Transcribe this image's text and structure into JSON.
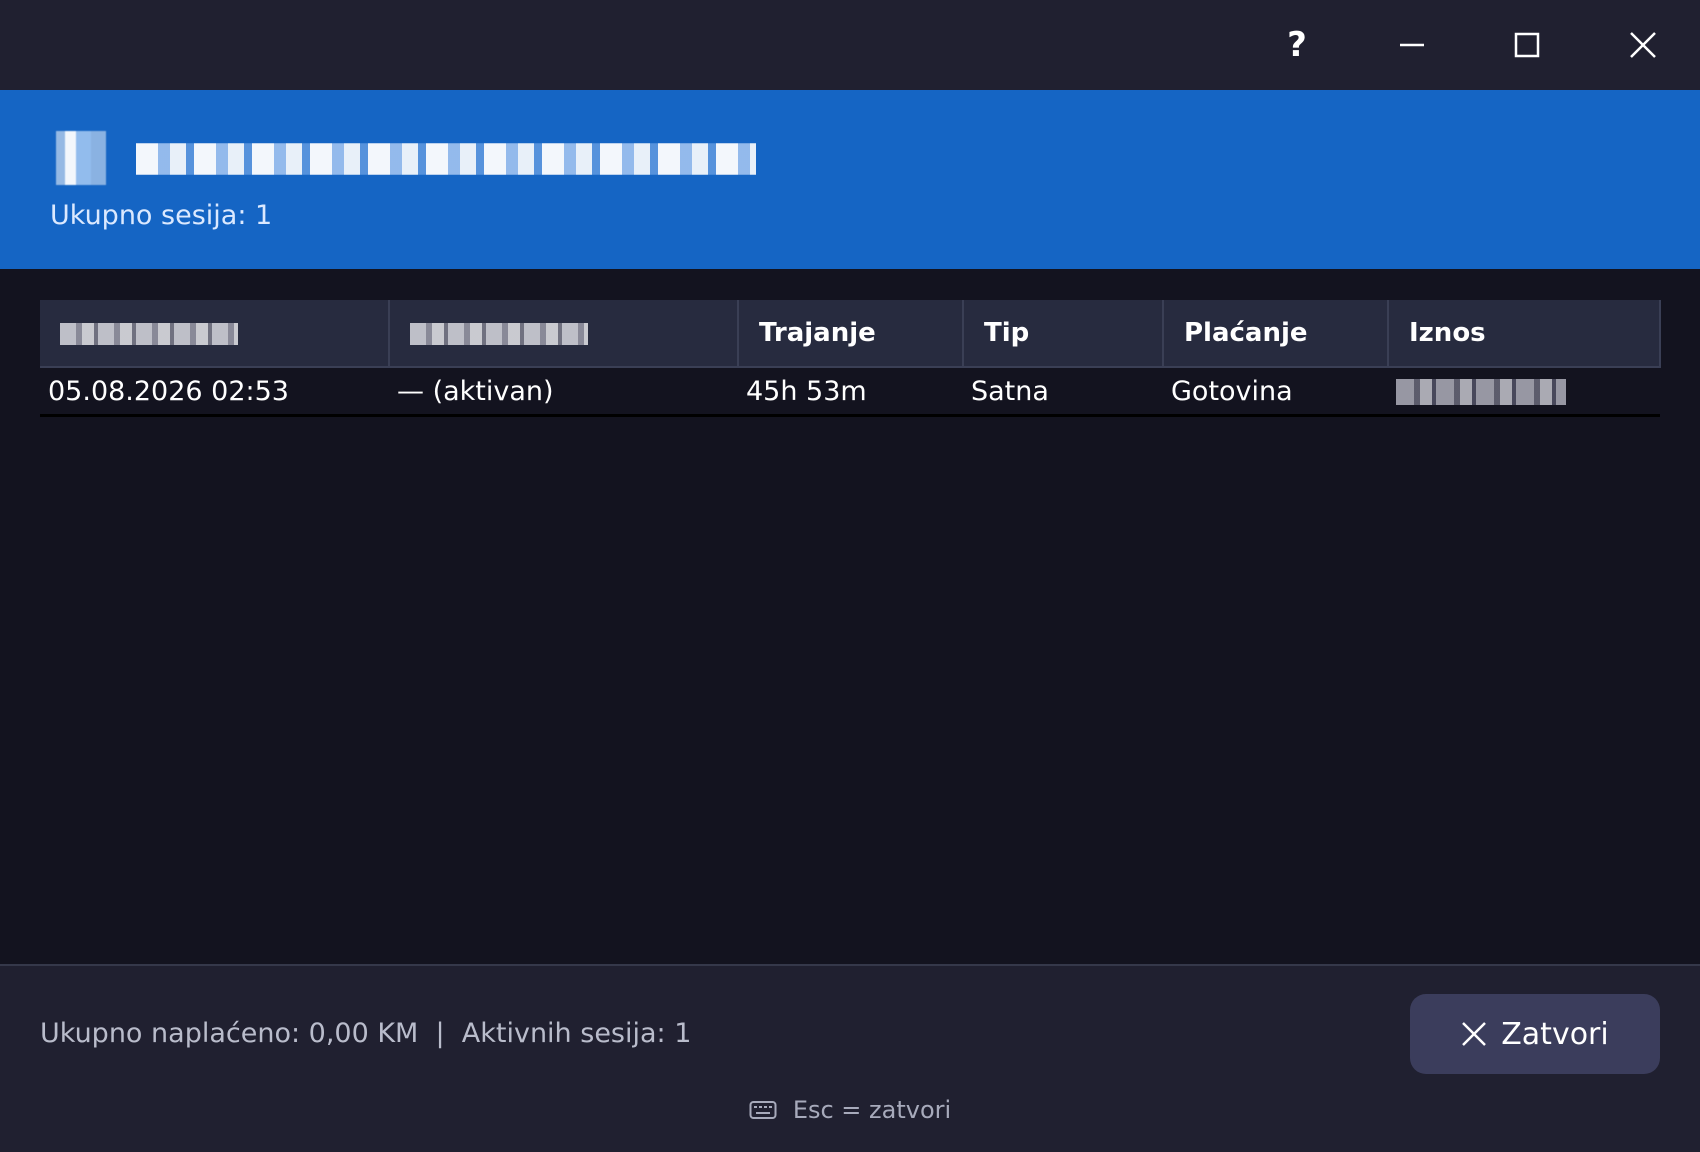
{
  "titlebar": {
    "help_label": "?",
    "icons": [
      "help-icon",
      "minimize-icon",
      "maximize-icon",
      "close-icon"
    ]
  },
  "header": {
    "title_redacted": "Historija vozila — T00TRPTPT",
    "subtitle": "Ukupno sesija: 1",
    "background_color": "#1565c4"
  },
  "table": {
    "columns": [
      "[redacted]",
      "[redacted]",
      "Trajanje",
      "Tip",
      "Plaćanje",
      "Iznos"
    ],
    "rows": [
      {
        "start": "05.08.2026 02:53",
        "end": "— (aktivan)",
        "duration": "45h 53m",
        "type": "Satna",
        "payment": "Gotovina",
        "amount_redacted": "[redacted]"
      }
    ]
  },
  "footer": {
    "summary": "Ukupno naplaćeno: 0,00 KM  |  Aktivnih sesija: 1",
    "close_button_label": "Zatvori",
    "shortcut_hint": "Esc = zatvori",
    "shortcut_icon": "keyboard-icon"
  },
  "colors": {
    "background": "#13131f",
    "titlebar": "#202030",
    "header": "#1565c4",
    "table_header": "#272b3f",
    "button": "#3b3d5c"
  }
}
